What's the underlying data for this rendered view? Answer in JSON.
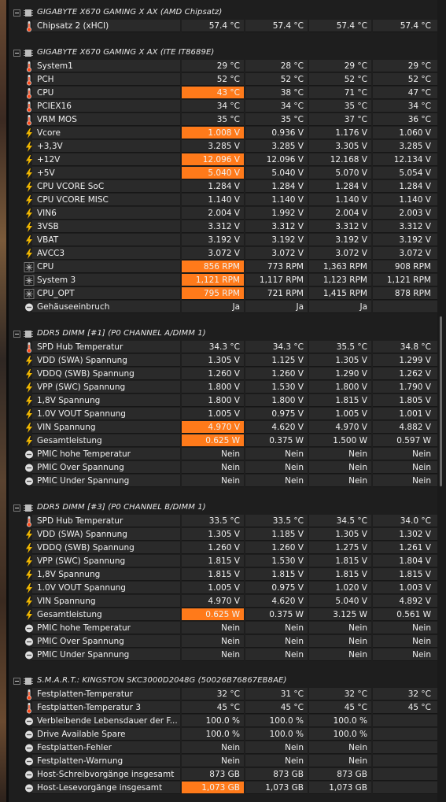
{
  "sections": [
    {
      "title": "GIGABYTE X670 GAMING X AX (AMD Chipsatz)",
      "rows": [
        {
          "icon": "thermometer",
          "label": "Chipsatz 2 (xHCI)",
          "v": [
            "57.4 °C",
            "57.4 °C",
            "57.4 °C",
            "57.4 °C"
          ],
          "hl": false
        }
      ]
    },
    {
      "title": "GIGABYTE X670 GAMING X AX (ITE IT8689E)",
      "rows": [
        {
          "icon": "thermometer",
          "label": "System1",
          "v": [
            "29 °C",
            "28 °C",
            "29 °C",
            "29 °C"
          ],
          "hl": false
        },
        {
          "icon": "thermometer",
          "label": "PCH",
          "v": [
            "52 °C",
            "52 °C",
            "52 °C",
            "52 °C"
          ],
          "hl": false
        },
        {
          "icon": "thermometer",
          "label": "CPU",
          "v": [
            "43 °C",
            "38 °C",
            "71 °C",
            "47 °C"
          ],
          "hl": true
        },
        {
          "icon": "thermometer",
          "label": "PCIEX16",
          "v": [
            "34 °C",
            "34 °C",
            "35 °C",
            "34 °C"
          ],
          "hl": false
        },
        {
          "icon": "thermometer",
          "label": "VRM MOS",
          "v": [
            "35 °C",
            "35 °C",
            "37 °C",
            "36 °C"
          ],
          "hl": false
        },
        {
          "icon": "bolt",
          "label": "Vcore",
          "v": [
            "1.008 V",
            "0.936 V",
            "1.176 V",
            "1.060 V"
          ],
          "hl": true
        },
        {
          "icon": "bolt",
          "label": "+3,3V",
          "v": [
            "3.285 V",
            "3.285 V",
            "3.305 V",
            "3.285 V"
          ],
          "hl": false
        },
        {
          "icon": "bolt",
          "label": "+12V",
          "v": [
            "12.096 V",
            "12.096 V",
            "12.168 V",
            "12.134 V"
          ],
          "hl": true
        },
        {
          "icon": "bolt",
          "label": "+5V",
          "v": [
            "5.040 V",
            "5.040 V",
            "5.070 V",
            "5.054 V"
          ],
          "hl": true
        },
        {
          "icon": "bolt",
          "label": "CPU VCORE SoC",
          "v": [
            "1.284 V",
            "1.284 V",
            "1.284 V",
            "1.284 V"
          ],
          "hl": false
        },
        {
          "icon": "bolt",
          "label": "CPU VCORE MISC",
          "v": [
            "1.140 V",
            "1.140 V",
            "1.140 V",
            "1.140 V"
          ],
          "hl": false
        },
        {
          "icon": "bolt",
          "label": "VIN6",
          "v": [
            "2.004 V",
            "1.992 V",
            "2.004 V",
            "2.003 V"
          ],
          "hl": false
        },
        {
          "icon": "bolt",
          "label": "3VSB",
          "v": [
            "3.312 V",
            "3.312 V",
            "3.312 V",
            "3.312 V"
          ],
          "hl": false
        },
        {
          "icon": "bolt",
          "label": "VBAT",
          "v": [
            "3.192 V",
            "3.192 V",
            "3.192 V",
            "3.192 V"
          ],
          "hl": false
        },
        {
          "icon": "bolt",
          "label": "AVCC3",
          "v": [
            "3.072 V",
            "3.072 V",
            "3.072 V",
            "3.072 V"
          ],
          "hl": false
        },
        {
          "icon": "fan",
          "label": "CPU",
          "v": [
            "856 RPM",
            "773 RPM",
            "1,363 RPM",
            "908 RPM"
          ],
          "hl": true
        },
        {
          "icon": "fan",
          "label": "System 3",
          "v": [
            "1,121 RPM",
            "1,117 RPM",
            "1,123 RPM",
            "1,121 RPM"
          ],
          "hl": true
        },
        {
          "icon": "fan",
          "label": "CPU_OPT",
          "v": [
            "795 RPM",
            "721 RPM",
            "1,415 RPM",
            "878 RPM"
          ],
          "hl": true
        },
        {
          "icon": "circle",
          "label": "Gehäuseeinbruch",
          "v": [
            "Ja",
            "Ja",
            "Ja",
            ""
          ],
          "hl": false
        }
      ]
    },
    {
      "title": "DDR5 DIMM [#1] (P0 CHANNEL A/DIMM 1)",
      "rows": [
        {
          "icon": "thermometer",
          "label": "SPD Hub Temperatur",
          "v": [
            "34.3 °C",
            "34.3 °C",
            "35.5 °C",
            "34.8 °C"
          ],
          "hl": false
        },
        {
          "icon": "bolt",
          "label": "VDD (SWA) Spannung",
          "v": [
            "1.305 V",
            "1.125 V",
            "1.305 V",
            "1.299 V"
          ],
          "hl": false
        },
        {
          "icon": "bolt",
          "label": "VDDQ (SWB) Spannung",
          "v": [
            "1.260 V",
            "1.260 V",
            "1.290 V",
            "1.262 V"
          ],
          "hl": false
        },
        {
          "icon": "bolt",
          "label": "VPP (SWC) Spannung",
          "v": [
            "1.800 V",
            "1.530 V",
            "1.800 V",
            "1.790 V"
          ],
          "hl": false
        },
        {
          "icon": "bolt",
          "label": "1,8V Spannung",
          "v": [
            "1.800 V",
            "1.800 V",
            "1.815 V",
            "1.805 V"
          ],
          "hl": false
        },
        {
          "icon": "bolt",
          "label": "1.0V VOUT Spannung",
          "v": [
            "1.005 V",
            "0.975 V",
            "1.005 V",
            "1.001 V"
          ],
          "hl": false
        },
        {
          "icon": "bolt",
          "label": "VIN Spannung",
          "v": [
            "4.970 V",
            "4.620 V",
            "4.970 V",
            "4.882 V"
          ],
          "hl": true
        },
        {
          "icon": "bolt",
          "label": "Gesamtleistung",
          "v": [
            "0.625 W",
            "0.375 W",
            "1.500 W",
            "0.597 W"
          ],
          "hl": true
        },
        {
          "icon": "circle",
          "label": "PMIC hohe Temperatur",
          "v": [
            "Nein",
            "Nein",
            "Nein",
            "Nein"
          ],
          "hl": false
        },
        {
          "icon": "circle",
          "label": "PMIC Over Spannung",
          "v": [
            "Nein",
            "Nein",
            "Nein",
            "Nein"
          ],
          "hl": false
        },
        {
          "icon": "circle",
          "label": "PMIC Under Spannung",
          "v": [
            "Nein",
            "Nein",
            "Nein",
            "Nein"
          ],
          "hl": false
        }
      ]
    },
    {
      "title": "DDR5 DIMM [#3] (P0 CHANNEL B/DIMM 1)",
      "rows": [
        {
          "icon": "thermometer",
          "label": "SPD Hub Temperatur",
          "v": [
            "33.5 °C",
            "33.5 °C",
            "34.5 °C",
            "34.0 °C"
          ],
          "hl": false
        },
        {
          "icon": "bolt",
          "label": "VDD (SWA) Spannung",
          "v": [
            "1.305 V",
            "1.185 V",
            "1.305 V",
            "1.302 V"
          ],
          "hl": false
        },
        {
          "icon": "bolt",
          "label": "VDDQ (SWB) Spannung",
          "v": [
            "1.260 V",
            "1.260 V",
            "1.275 V",
            "1.261 V"
          ],
          "hl": false
        },
        {
          "icon": "bolt",
          "label": "VPP (SWC) Spannung",
          "v": [
            "1.815 V",
            "1.530 V",
            "1.815 V",
            "1.804 V"
          ],
          "hl": false
        },
        {
          "icon": "bolt",
          "label": "1,8V Spannung",
          "v": [
            "1.815 V",
            "1.815 V",
            "1.815 V",
            "1.815 V"
          ],
          "hl": false
        },
        {
          "icon": "bolt",
          "label": "1.0V VOUT Spannung",
          "v": [
            "1.005 V",
            "0.975 V",
            "1.020 V",
            "1.003 V"
          ],
          "hl": false
        },
        {
          "icon": "bolt",
          "label": "VIN Spannung",
          "v": [
            "4.970 V",
            "4.620 V",
            "5.040 V",
            "4.892 V"
          ],
          "hl": false
        },
        {
          "icon": "bolt",
          "label": "Gesamtleistung",
          "v": [
            "0.625 W",
            "0.375 W",
            "3.125 W",
            "0.561 W"
          ],
          "hl": true
        },
        {
          "icon": "circle",
          "label": "PMIC hohe Temperatur",
          "v": [
            "Nein",
            "Nein",
            "Nein",
            "Nein"
          ],
          "hl": false
        },
        {
          "icon": "circle",
          "label": "PMIC Over Spannung",
          "v": [
            "Nein",
            "Nein",
            "Nein",
            "Nein"
          ],
          "hl": false
        },
        {
          "icon": "circle",
          "label": "PMIC Under Spannung",
          "v": [
            "Nein",
            "Nein",
            "Nein",
            "Nein"
          ],
          "hl": false
        }
      ]
    },
    {
      "title": "S.M.A.R.T.: KINGSTON SKC3000D2048G (50026B76867EB8AE)",
      "rows": [
        {
          "icon": "thermometer",
          "label": "Festplatten-Temperatur",
          "v": [
            "32 °C",
            "31 °C",
            "32 °C",
            "32 °C"
          ],
          "hl": false
        },
        {
          "icon": "thermometer",
          "label": "Festplatten-Temperatur 3",
          "v": [
            "45 °C",
            "45 °C",
            "45 °C",
            "45 °C"
          ],
          "hl": false
        },
        {
          "icon": "circle",
          "label": "Verbleibende Lebensdauer der F...",
          "v": [
            "100.0 %",
            "100.0 %",
            "100.0 %",
            ""
          ],
          "hl": false
        },
        {
          "icon": "circle",
          "label": "Drive Available Spare",
          "v": [
            "100.0 %",
            "100.0 %",
            "100.0 %",
            ""
          ],
          "hl": false
        },
        {
          "icon": "circle",
          "label": "Festplatten-Fehler",
          "v": [
            "Nein",
            "Nein",
            "Nein",
            ""
          ],
          "hl": false
        },
        {
          "icon": "circle",
          "label": "Festplatten-Warnung",
          "v": [
            "Nein",
            "Nein",
            "Nein",
            ""
          ],
          "hl": false
        },
        {
          "icon": "circle",
          "label": "Host-Schreibvorgänge insgesamt",
          "v": [
            "873 GB",
            "873 GB",
            "873 GB",
            ""
          ],
          "hl": false
        },
        {
          "icon": "circle",
          "label": "Host-Lesevorgänge insgesamt",
          "v": [
            "1,073 GB",
            "1,073 GB",
            "1,073 GB",
            ""
          ],
          "hl": true
        }
      ]
    }
  ],
  "colors": {
    "highlight": "#ff7a1a",
    "cell": "#2a2a2a",
    "bolt": "#f2b800",
    "thermo": "#ff5a2a"
  }
}
